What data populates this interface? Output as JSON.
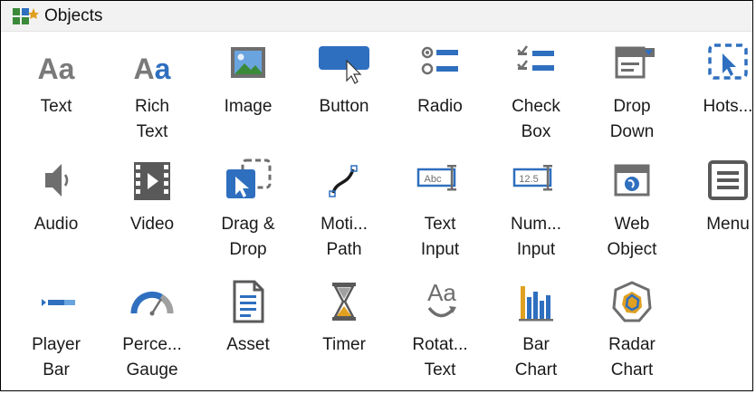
{
  "panel": {
    "title": "Objects",
    "title_icon": "objects-panel-icon"
  },
  "colors": {
    "icon_gray": "#7a7a7a",
    "icon_dark": "#595959",
    "icon_blue": "#2f6fbf",
    "icon_light_blue": "#6aa4de",
    "titlebar_bg": "#f2f2f2"
  },
  "items": [
    {
      "id": "text",
      "label": "Text",
      "icon": "text-aa-icon"
    },
    {
      "id": "rich-text",
      "label": "Rich\nText",
      "icon": "rich-text-aa-icon"
    },
    {
      "id": "image",
      "label": "Image",
      "icon": "image-icon"
    },
    {
      "id": "button",
      "label": "Button",
      "icon": "button-icon"
    },
    {
      "id": "radio",
      "label": "Radio",
      "icon": "radio-icon"
    },
    {
      "id": "check-box",
      "label": "Check\nBox",
      "icon": "checkbox-icon"
    },
    {
      "id": "drop-down",
      "label": "Drop\nDown",
      "icon": "dropdown-icon"
    },
    {
      "id": "hotspot",
      "label": "Hots...",
      "icon": "hotspot-icon"
    },
    {
      "id": "audio",
      "label": "Audio",
      "icon": "speaker-icon"
    },
    {
      "id": "video",
      "label": "Video",
      "icon": "film-icon"
    },
    {
      "id": "drag-drop",
      "label": "Drag &\nDrop",
      "icon": "drag-drop-icon"
    },
    {
      "id": "motion-path",
      "label": "Moti...\nPath",
      "icon": "motion-path-icon"
    },
    {
      "id": "text-input",
      "label": "Text\nInput",
      "icon": "text-input-icon"
    },
    {
      "id": "numeric-input",
      "label": "Num...\nInput",
      "icon": "numeric-input-icon"
    },
    {
      "id": "web-object",
      "label": "Web\nObject",
      "icon": "globe-window-icon"
    },
    {
      "id": "menu",
      "label": "Menu",
      "icon": "menu-icon"
    },
    {
      "id": "player-bar",
      "label": "Player\nBar",
      "icon": "player-bar-icon"
    },
    {
      "id": "percent-gauge",
      "label": "Perce...\nGauge",
      "icon": "gauge-icon"
    },
    {
      "id": "asset",
      "label": "Asset",
      "icon": "document-icon"
    },
    {
      "id": "timer",
      "label": "Timer",
      "icon": "hourglass-icon"
    },
    {
      "id": "rotating-text",
      "label": "Rotat...\nText",
      "icon": "rotating-text-icon"
    },
    {
      "id": "bar-chart",
      "label": "Bar\nChart",
      "icon": "bar-chart-icon"
    },
    {
      "id": "radar-chart",
      "label": "Radar\nChart",
      "icon": "radar-chart-icon"
    }
  ]
}
